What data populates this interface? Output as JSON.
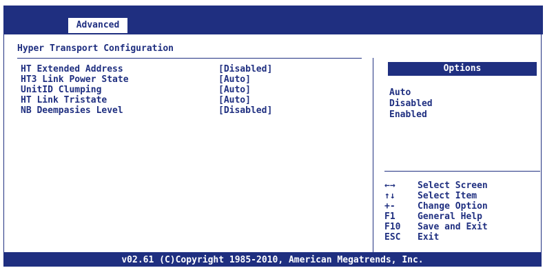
{
  "header": {
    "active_tab": "Advanced"
  },
  "page_title": "Hyper Transport Configuration",
  "settings": [
    {
      "label": "HT Extended Address",
      "value": "[Disabled]"
    },
    {
      "label": "HT3 Link Power State",
      "value": "[Auto]"
    },
    {
      "label": "UnitID Clumping",
      "value": "[Auto]"
    },
    {
      "label": "HT Link Tristate",
      "value": "[Auto]"
    },
    {
      "label": "NB Deempasies Level",
      "value": "[Disabled]"
    }
  ],
  "options": {
    "title": "Options",
    "items": [
      "Auto",
      "Disabled",
      "Enabled"
    ]
  },
  "help": [
    {
      "key": "←→",
      "desc": "Select Screen"
    },
    {
      "key": "↑↓",
      "desc": "Select Item"
    },
    {
      "key": "+-",
      "desc": "Change Option"
    },
    {
      "key": "F1",
      "desc": "General Help"
    },
    {
      "key": "F10",
      "desc": "Save and Exit"
    },
    {
      "key": "ESC",
      "desc": "Exit"
    }
  ],
  "footer": "v02.61 (C)Copyright 1985-2010, American Megatrends, Inc.",
  "colors": {
    "primary": "#1f2f80",
    "background": "#ffffff"
  }
}
